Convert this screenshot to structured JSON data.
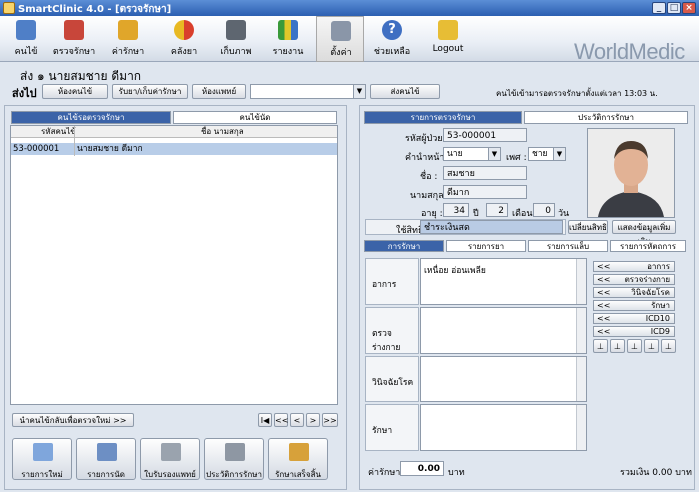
{
  "window": {
    "title": "SmartClinic 4.0 - [ตรวจรักษา]"
  },
  "toolbar": {
    "items": [
      {
        "label": "คนไข้"
      },
      {
        "label": "ตรวจรักษา"
      },
      {
        "label": "ค่ารักษา"
      },
      {
        "label": "คลังยา"
      },
      {
        "label": "เก็บภาพ"
      },
      {
        "label": "รายงาน"
      },
      {
        "label": "ตั้งค่า"
      },
      {
        "label": "ช่วยเหลือ"
      },
      {
        "label": "Logout"
      }
    ],
    "logo": "WorldMedic"
  },
  "header": {
    "patient_line": "ส่ง  ๑ นายสมชาย ดีมาก",
    "send_label": "ส่งไป",
    "buttons": [
      "ห้องคนไข้",
      "รับยา/เก็บค่ารักษา",
      "ห้องแพทย์"
    ],
    "send_button": "ส่งคนไข้",
    "wait_text": "คนไข้เข้ามารอตรวจรักษาตั้งแต่เวลา 13:03 น."
  },
  "left": {
    "tabs": [
      "คนไข้รอตรวจรักษา",
      "คนไข้นัด"
    ],
    "columns": [
      "รหัสคนไข้",
      "ชื่อ นามสกุล"
    ],
    "rows": [
      {
        "id": "53-000001",
        "name": "นายสมชาย ดีมาก"
      }
    ],
    "bring_back_button": "นำคนไข้กลับเพื่อตรวจใหม่ >>",
    "pager": [
      "I◀",
      "<<",
      "<",
      ">",
      ">>"
    ],
    "actions": [
      "รายการใหม่",
      "รายการนัด",
      "ใบรับรองแพทย์",
      "ประวัติการรักษา",
      "รักษาเสร็จสิ้น"
    ]
  },
  "right": {
    "tabs": [
      "รายการตรวจรักษา",
      "ประวัติการรักษา"
    ],
    "fields": {
      "patient_id_label": "รหัสผู้ป่วย :",
      "patient_id": "53-000001",
      "prefix_label": "คำนำหน้า :",
      "prefix": "นาย",
      "sex_label": "เพศ :",
      "sex": "ชาย",
      "first_name_label": "ชื่อ :",
      "first_name": "สมชาย",
      "last_name_label": "นามสกุล :",
      "last_name": "ดีมาก",
      "age_label": "อายุ :",
      "age_years": "34",
      "years_unit": "ปี",
      "age_months": "2",
      "months_unit": "เดือน",
      "age_days": "0",
      "days_unit": "วัน",
      "right_label": "ใช้สิทธิ :",
      "right_value": "ชำระเงินสด",
      "change_right_button": "เปลี่ยนสิทธิ",
      "more_info_button": "แสดงข้อมูลเพิ่มเติม"
    },
    "subtabs": [
      "การรักษา",
      "รายการยา",
      "รายการแล็บ",
      "รายการหัตถการ"
    ],
    "sections": [
      {
        "label": "อาการ",
        "value": "เหนื่อย อ่อนเพลีย"
      },
      {
        "label": "ตรวจร่างกาย",
        "value": ""
      },
      {
        "label": "วินิจฉัยโรค",
        "value": ""
      },
      {
        "label": "รักษา",
        "value": ""
      }
    ],
    "side_buttons": [
      "อาการ",
      "ตรวจร่างกาย",
      "วินิจฉัยโรค",
      "รักษา",
      "ICD10",
      "ICD9"
    ],
    "arrow": "<<",
    "fee_label": "ค่ารักษา :",
    "fee_value": "0.00",
    "fee_unit": "บาท",
    "total_text": "รวมเงิน 0.00 บาท"
  },
  "colors": {
    "tab_active": "#3b63a8",
    "titlebar": "#2c5fb1",
    "selected_row": "#b8cde8"
  }
}
